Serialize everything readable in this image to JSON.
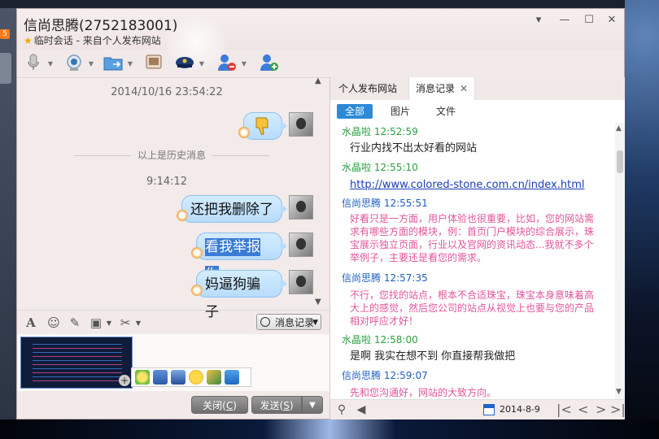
{
  "window": {
    "title": "信尚思腾(2752183001)",
    "subtitle": "临时会话 - 来自个人发布网站",
    "controls": {
      "menu": "▾",
      "minimize": "—",
      "maximize": "☐",
      "close": "✕"
    }
  },
  "desktop": {
    "badge": "5"
  },
  "toolbar": {
    "items": [
      "voice-icon",
      "video-icon",
      "file-transfer-icon",
      "remote-desktop-icon",
      "police-report-icon",
      "block-user-icon",
      "add-friend-icon"
    ]
  },
  "chat": {
    "timestamp1": "2014/10/16 23:54:22",
    "history_divider": "以上是历史消息",
    "timestamp2": "9:14:12",
    "messages": [
      {
        "text": "还把我删除了"
      },
      {
        "text": "看我举报你",
        "selected": true
      },
      {
        "text": "妈逼狗骗子"
      }
    ]
  },
  "format": {
    "history_button": "消息记录"
  },
  "buttons": {
    "close_label": "关闭",
    "close_key": "C",
    "send_label": "发送",
    "send_key": "S"
  },
  "right_panel": {
    "tabs": [
      {
        "label": "个人发布网站",
        "active": false
      },
      {
        "label": "消息记录",
        "active": true
      }
    ],
    "filters": [
      "全部",
      "图片",
      "文件"
    ],
    "messages": [
      {
        "sender": "水晶啦",
        "time": "12:52:59",
        "color": "green",
        "body": "行业内找不出太好看的网站",
        "style": "dark"
      },
      {
        "sender": "水晶啦",
        "time": "12:55:10",
        "color": "green",
        "body": "http://www.colored-stone.com.cn/index.html",
        "style": "link"
      },
      {
        "sender": "信尚思腾",
        "time": "12:55:51",
        "color": "blue",
        "body": "好看只是一方面，用户体验也很重要，比如，您的网站需求有哪些方面的模块，例：首页门户模块的综合展示，珠宝展示独立页面，行业以及官网的资讯动态...我就不多个举例子，主要还是看您的需求。",
        "style": "pink"
      },
      {
        "sender": "信尚思腾",
        "time": "12:57:35",
        "color": "blue",
        "body": "不行，您找的站点，根本不合适珠宝，珠宝本身意味着高大上的感觉，然后您公司的站点从视觉上也要与您的产品相对呼应才好！",
        "style": "pink"
      },
      {
        "sender": "水晶啦",
        "time": "12:58:00",
        "color": "green",
        "body": "是啊 我实在想不到  你直接帮我做把",
        "style": "dark"
      },
      {
        "sender": "信尚思腾",
        "time": "12:59:07",
        "color": "blue",
        "body": "先和您沟通好，网站的大致方向。",
        "style": "pink"
      }
    ],
    "date": "2014-8-9"
  },
  "colors": {
    "accent": "#2b8ad6",
    "green_sender": "#2aa040",
    "blue_sender": "#1f5fbf",
    "pink_text": "#e2559c",
    "bubble": "#b8dcfb"
  }
}
